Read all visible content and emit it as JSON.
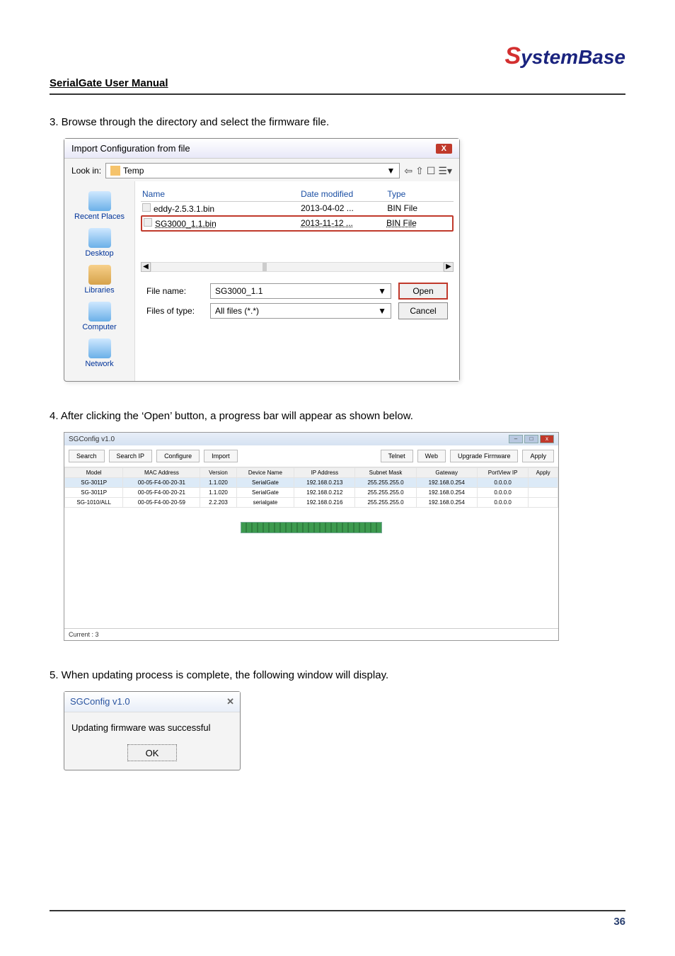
{
  "brand": {
    "s": "S",
    "rest": "ystemBase"
  },
  "header": "SerialGate User Manual",
  "steps": {
    "s3": "3. Browse through the directory and select the firmware file.",
    "s4": "4. After clicking the ‘Open’ button, a progress bar will appear as shown below.",
    "s5": "5. When updating process is complete, the following window will display."
  },
  "file_dialog": {
    "title": "Import Configuration from file",
    "lookin_label": "Look in:",
    "lookin_value": "Temp",
    "toolbar_glyphs": {
      "back": "⇦",
      "up": "⇧",
      "new": "☐",
      "view": "☰▾"
    },
    "cols": {
      "name": "Name",
      "date": "Date modified",
      "type": "Type"
    },
    "rows": [
      {
        "name": "eddy-2.5.3.1.bin",
        "date": "2013-04-02 ...",
        "type": "BIN File"
      },
      {
        "name": "SG3000_1.1.bin",
        "date": "2013-11-12 ...",
        "type": "BIN File"
      }
    ],
    "sidebar": [
      "Recent Places",
      "Desktop",
      "Libraries",
      "Computer",
      "Network"
    ],
    "filename_label": "File name:",
    "filename_value": "SG3000_1.1",
    "filetype_label": "Files of type:",
    "filetype_value": "All files (*.*)",
    "open": "Open",
    "cancel": "Cancel"
  },
  "sgconfig": {
    "title": "SGConfig v1.0",
    "toolbar": [
      "Search",
      "Search IP",
      "Configure",
      "Import",
      "Telnet",
      "Web",
      "Upgrade Firmware",
      "Apply"
    ],
    "headers": [
      "Model",
      "MAC Address",
      "Version",
      "Device Name",
      "IP Address",
      "Subnet Mask",
      "Gateway",
      "PortView IP",
      "Apply"
    ],
    "rows": [
      [
        "SG-3011P",
        "00-05-F4-00-20-31",
        "1.1.020",
        "SerialGate",
        "192.168.0.213",
        "255.255.255.0",
        "192.168.0.254",
        "0.0.0.0",
        ""
      ],
      [
        "SG-3011P",
        "00-05-F4-00-20-21",
        "1.1.020",
        "SerialGate",
        "192.168.0.212",
        "255.255.255.0",
        "192.168.0.254",
        "0.0.0.0",
        ""
      ],
      [
        "SG-1010/ALL",
        "00-05-F4-00-20-59",
        "2.2.203",
        "serialgate",
        "192.168.0.216",
        "255.255.255.0",
        "192.168.0.254",
        "0.0.0.0",
        ""
      ]
    ],
    "status": "Current : 3"
  },
  "msgbox": {
    "title": "SGConfig v1.0",
    "text": "Updating firmware was successful",
    "ok": "OK"
  },
  "page_number": "36"
}
